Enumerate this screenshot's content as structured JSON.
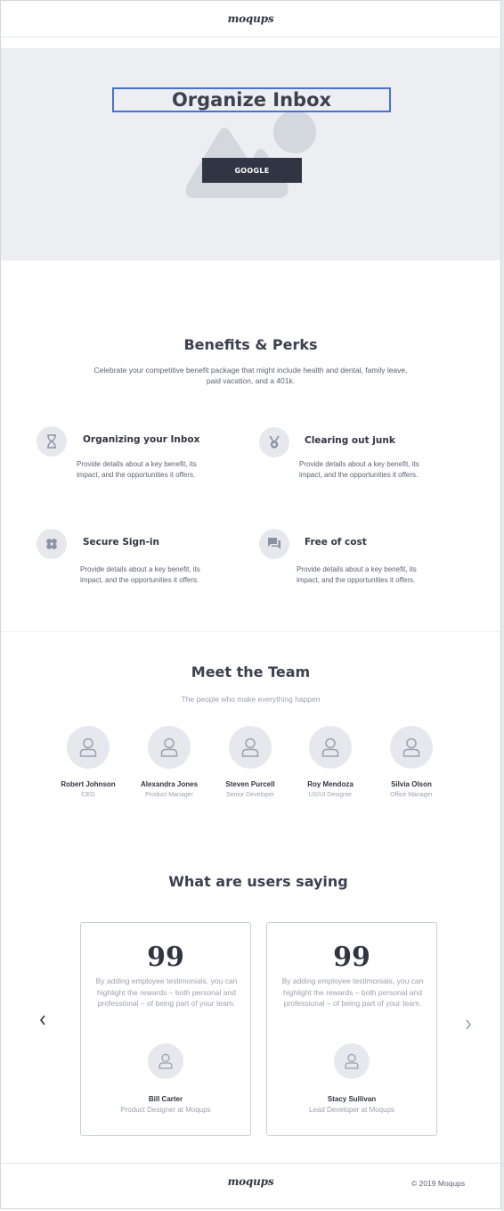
{
  "header": {
    "logo": "moqups"
  },
  "hero": {
    "title": "Organize Inbox",
    "button_label": "GOOGLE"
  },
  "benefits": {
    "title": "Benefits & Perks",
    "subtitle": "Celebrate your competitive benefit package that might include health and dental, family leave, paid vacation, and a 401k.",
    "items": [
      {
        "title": "Organizing your Inbox",
        "text": "Provide details about a key benefit, its impact, and the opportunities it offers.",
        "icon": "hourglass-icon"
      },
      {
        "title": "Clearing out junk",
        "text": "Provide details about a key benefit, its impact, and the opportunities it offers.",
        "icon": "medal-icon"
      },
      {
        "title": "Secure Sign-in",
        "text": "Provide details about a key benefit, its impact, and the opportunities it offers.",
        "icon": "bandage-icon"
      },
      {
        "title": "Free of cost",
        "text": "Provide details about a key benefit, its impact, and the opportunities it offers.",
        "icon": "chat-icon"
      }
    ]
  },
  "team": {
    "title": "Meet the Team",
    "subtitle": "The people who make everything happen",
    "members": [
      {
        "name": "Robert Johnson",
        "role": "CEO"
      },
      {
        "name": "Alexandra Jones",
        "role": "Product Manager"
      },
      {
        "name": "Steven Purcell",
        "role": "Senior Developer"
      },
      {
        "name": "Roy Mendoza",
        "role": "UX/UI Designer"
      },
      {
        "name": "Silvia Olson",
        "role": "Office Manager"
      }
    ]
  },
  "testimonials": {
    "title": "What are users saying",
    "quote_mark": "99",
    "prev_icon": "chevron-left-icon",
    "next_icon": "chevron-right-icon",
    "items": [
      {
        "text": "By adding employee testimonials, you can highlight the rewards – both personal and professional – of being part of your team.",
        "name": "Bill Carter",
        "role": "Product Designer at Moqups"
      },
      {
        "text": "By adding employee testimonials, you can highlight the rewards – both personal and professional – of being part of your team.",
        "name": "Stacy Sullivan",
        "role": "Lead Developer at Moqups"
      }
    ]
  },
  "footer": {
    "logo": "moqups",
    "copyright": "© 2019  Moqups"
  },
  "colors": {
    "accent": "#4a70d4",
    "dark": "#2f3542",
    "hero_bg": "#eceef2",
    "muted": "#9aa1ae"
  }
}
